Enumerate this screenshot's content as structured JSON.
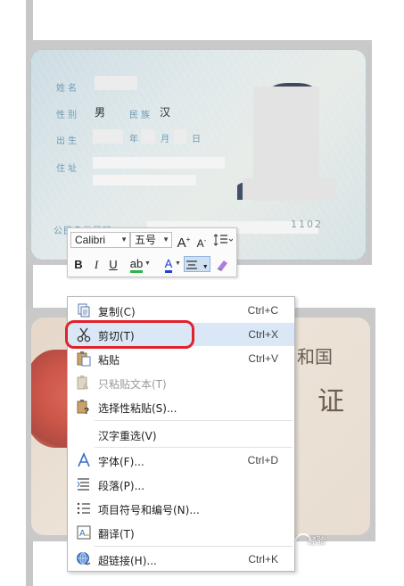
{
  "card_front": {
    "name_label": "姓名",
    "sex_label": "性别",
    "sex_value": "男",
    "ethnicity_label": "民族",
    "ethnicity_value": "汉",
    "birth_label": "出生",
    "birth_year_unit": "年",
    "birth_month_unit": "月",
    "birth_day_unit": "日",
    "address_label": "住址",
    "id_label": "公民身份号码",
    "id_tail": "1102"
  },
  "card_back": {
    "line1": "和国",
    "line2": "证"
  },
  "mini_toolbar": {
    "font_name": "Calibri",
    "font_size": "五号",
    "grow_font": "A",
    "shrink_font": "A",
    "bold": "B",
    "italic": "I",
    "underline": "U",
    "highlight": "ab",
    "font_color": "A",
    "font_color_hex": "#1f3fcf",
    "highlight_hex": "#2db34a"
  },
  "context_menu": {
    "items": [
      {
        "icon": "copy-icon",
        "label": "复制(C)",
        "shortcut": "Ctrl+C",
        "enabled": true
      },
      {
        "icon": "scissors-icon",
        "label": "剪切(T)",
        "shortcut": "Ctrl+X",
        "enabled": true
      },
      {
        "icon": "paste-icon",
        "label": "粘贴",
        "shortcut": "Ctrl+V",
        "enabled": true
      },
      {
        "icon": "paste-text-icon",
        "label": "只粘贴文本(T)",
        "shortcut": "",
        "enabled": false
      },
      {
        "icon": "paste-special-icon",
        "label": "选择性粘贴(S)...",
        "shortcut": "",
        "enabled": true
      },
      {
        "icon": "",
        "label": "汉字重选(V)",
        "shortcut": "",
        "enabled": true
      },
      {
        "icon": "font-icon",
        "label": "字体(F)...",
        "shortcut": "Ctrl+D",
        "enabled": true
      },
      {
        "icon": "paragraph-icon",
        "label": "段落(P)...",
        "shortcut": "",
        "enabled": true
      },
      {
        "icon": "bullets-icon",
        "label": "项目符号和编号(N)...",
        "shortcut": "",
        "enabled": true
      },
      {
        "icon": "translate-icon",
        "label": "翻译(T)",
        "shortcut": "",
        "enabled": true
      },
      {
        "icon": "hyperlink-icon",
        "label": "超链接(H)...",
        "shortcut": "Ctrl+K",
        "enabled": true
      }
    ],
    "highlighted_item": "剪切(T)",
    "annotation_color": "#e0232b"
  },
  "watermark": "经验"
}
